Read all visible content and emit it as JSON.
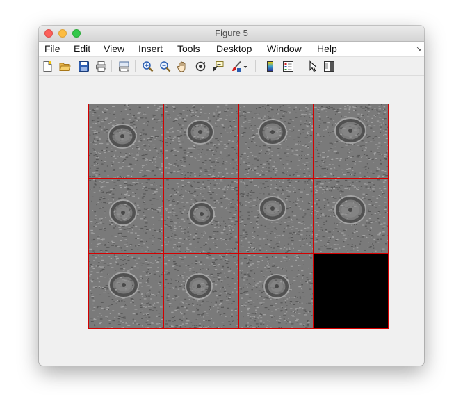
{
  "window": {
    "title": "Figure 5"
  },
  "menubar": {
    "items": [
      {
        "label": "File"
      },
      {
        "label": "Edit"
      },
      {
        "label": "View"
      },
      {
        "label": "Insert"
      },
      {
        "label": "Tools"
      },
      {
        "label": "Desktop"
      },
      {
        "label": "Window"
      },
      {
        "label": "Help"
      }
    ]
  },
  "toolbar": {
    "icons": [
      "new-figure-icon",
      "open-file-icon",
      "save-icon",
      "print-icon",
      "print-preview-icon",
      "zoom-in-icon",
      "zoom-out-icon",
      "pan-hand-icon",
      "rotate-3d-icon",
      "data-cursor-icon",
      "brush-icon",
      "colorbar-icon",
      "legend-icon",
      "edit-plot-arrow-icon",
      "property-inspector-icon"
    ]
  },
  "montage": {
    "rows": 3,
    "cols": 4,
    "filled_tiles": 11,
    "border_color": "#d40000",
    "empty_color": "#000000"
  }
}
